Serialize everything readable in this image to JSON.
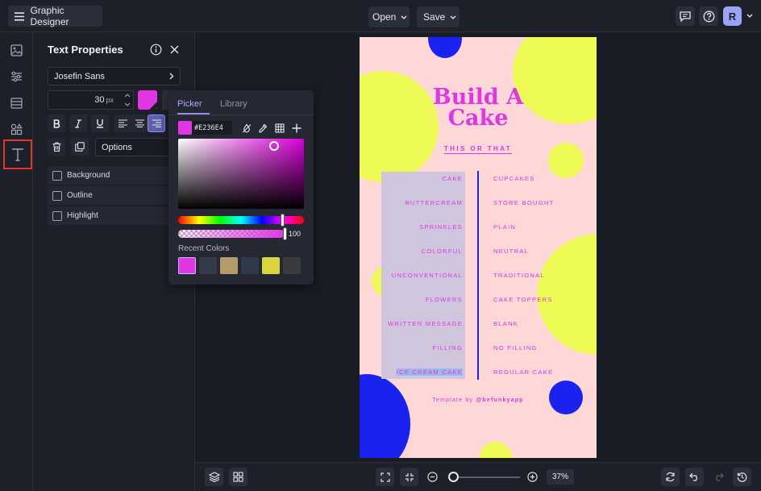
{
  "header": {
    "app_title": "Graphic Designer",
    "open_label": "Open",
    "save_label": "Save",
    "avatar_initial": "R"
  },
  "sidebar": {
    "tools": [
      "image-icon",
      "sliders-icon",
      "layout-icon",
      "shapes-icon",
      "text-icon"
    ],
    "active_tool": "text-icon"
  },
  "text_properties": {
    "title": "Text Properties",
    "font": "Josefin Sans",
    "size_value": "30",
    "size_unit": "px",
    "color": "#E236E4",
    "options_label": "Options",
    "checkboxes": [
      {
        "label": "Background",
        "checked": false
      },
      {
        "label": "Outline",
        "checked": false
      },
      {
        "label": "Highlight",
        "checked": false
      }
    ]
  },
  "color_picker": {
    "tabs": [
      "Picker",
      "Library"
    ],
    "active_tab": "Picker",
    "hex": "#E236E4",
    "opacity": "100",
    "recent_label": "Recent Colors",
    "recent_colors": [
      "#E236E4",
      "#343a4a",
      "#b59a6a",
      "#2f3a4a",
      "#d8d63c",
      "#3a3b3f"
    ]
  },
  "poster": {
    "title_line1": "Build A",
    "title_line2": "Cake",
    "subtitle": "THIS OR THAT",
    "left_options": [
      "CAKE",
      "BUTTERCREAM",
      "SPRINKLES",
      "COLORFUL",
      "UNCONVENTIONAL",
      "FLOWERS",
      "WRITTEN MESSAGE",
      "FILLING",
      "ICE CREAM CAKE"
    ],
    "right_options": [
      "CUPCAKES",
      "STORE BOUGHT",
      "PLAIN",
      "NEUTRAL",
      "TRADITIONAL",
      "CAKE TOPPERS",
      "BLANK",
      "NO FILLING",
      "REGULAR CAKE"
    ],
    "credit_prefix": "Template by",
    "credit_handle": "@befunkyapp",
    "colors": {
      "background": "#fdd8d6",
      "accent": "#e236e4",
      "blue": "#1a22f0",
      "lime": "#eefa55"
    }
  },
  "footer": {
    "zoom": "37%"
  }
}
